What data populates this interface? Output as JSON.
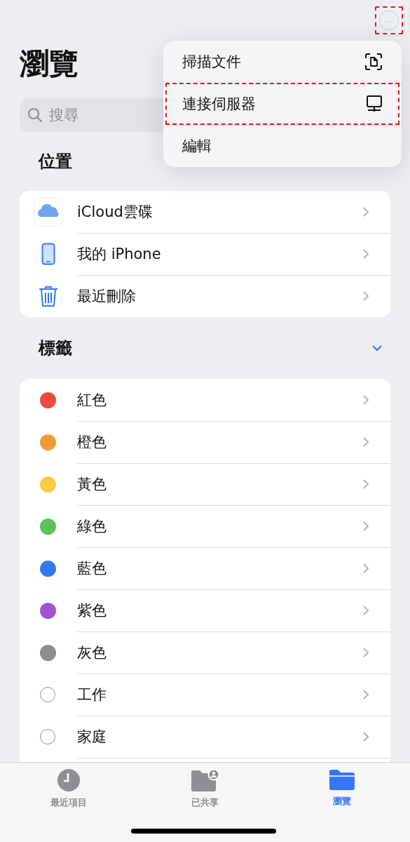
{
  "more_button": {
    "label": "···",
    "highlighted": true
  },
  "menu": [
    {
      "label": "掃描文件",
      "kind": "scan",
      "highlighted": false
    },
    {
      "label": "連接伺服器",
      "kind": "server",
      "highlighted": true
    },
    {
      "label": "編輯",
      "kind": "plain",
      "highlighted": false
    }
  ],
  "title": "瀏覽",
  "search": {
    "placeholder": "搜尋"
  },
  "locations": {
    "heading": "位置",
    "items": [
      {
        "label": "iCloud雲碟",
        "kind": "cloud"
      },
      {
        "label": "我的 iPhone",
        "kind": "device"
      },
      {
        "label": "最近刪除",
        "kind": "trash"
      }
    ]
  },
  "tags": {
    "heading": "標籤",
    "expanded": true,
    "items": [
      {
        "label": "紅色",
        "kind": "dot",
        "color": "#eb4a3d"
      },
      {
        "label": "橙色",
        "kind": "dot",
        "color": "#f09a37"
      },
      {
        "label": "黃色",
        "kind": "dot",
        "color": "#f7cd46"
      },
      {
        "label": "綠色",
        "kind": "dot",
        "color": "#5ec25a"
      },
      {
        "label": "藍色",
        "kind": "dot",
        "color": "#3478f6"
      },
      {
        "label": "紫色",
        "kind": "dot",
        "color": "#a354d6"
      },
      {
        "label": "灰色",
        "kind": "dot",
        "color": "#8e8e93"
      },
      {
        "label": "工作",
        "kind": "ring"
      },
      {
        "label": "家庭",
        "kind": "ring"
      }
    ]
  },
  "tab_bar": [
    {
      "label": "最近項目",
      "kind": "recents",
      "selected": false
    },
    {
      "label": "已共享",
      "kind": "shared",
      "selected": false
    },
    {
      "label": "瀏覽",
      "kind": "browse",
      "selected": true
    }
  ]
}
